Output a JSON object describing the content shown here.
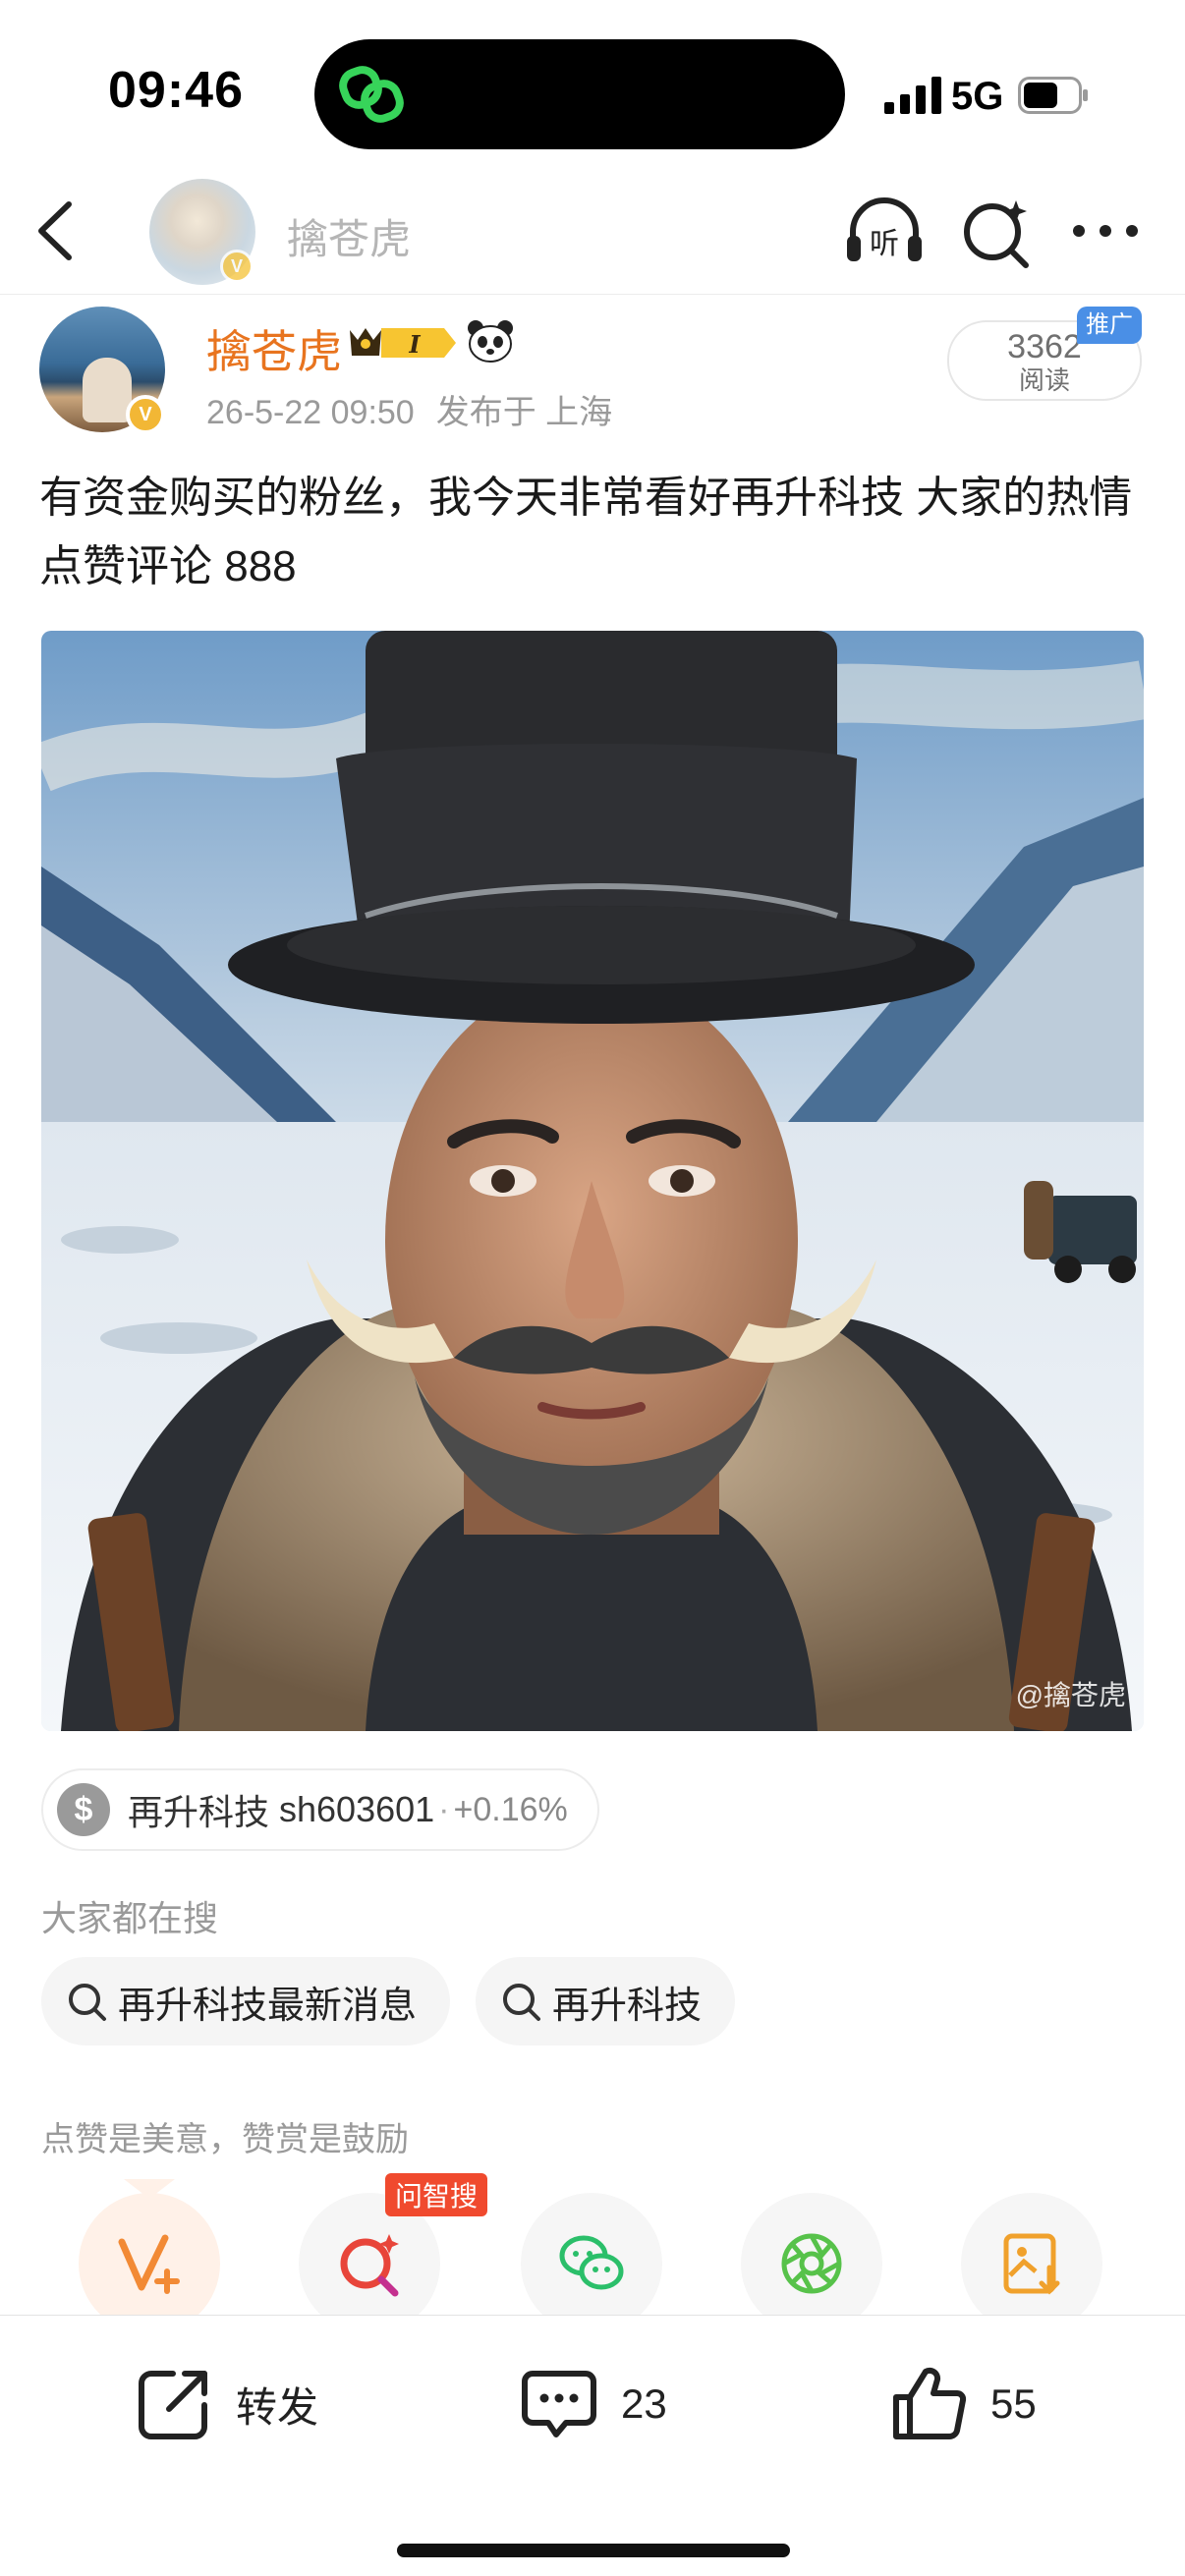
{
  "status_bar": {
    "time": "09:46",
    "network": "5G"
  },
  "nav": {
    "title": "擒苍虎",
    "icons": [
      "back-icon",
      "listen-icon",
      "ai-search-icon",
      "more-icon"
    ]
  },
  "author": {
    "name": "擒苍虎",
    "verified_badge": "V",
    "level_badge": "I",
    "timestamp": "26-5-22 09:50",
    "location": "发布于 上海",
    "reads": "3362",
    "reads_label": "阅读",
    "promo_tag": "推广"
  },
  "post": {
    "text": "有资金购买的粉丝，我今天非常看好再升科技 大家的热情点赞评论 888",
    "image_watermark": "@擒苍虎"
  },
  "stock": {
    "icon": "$",
    "name": "再升科技",
    "code": "sh603601",
    "separator": "·",
    "change": "+0.16%"
  },
  "searching": {
    "heading": "大家都在搜",
    "items": [
      "再升科技最新消息",
      "再升科技"
    ]
  },
  "reward_text": "点赞是美意，赞赏是鼓励",
  "share": {
    "ask_tag": "问智搜",
    "colors": {
      "reward": "#f28a35",
      "ask": "#e8453a",
      "wechat": "#2bbf6a",
      "moments": "#57c24a",
      "save": "#f0a12c"
    }
  },
  "actions": {
    "repost_label": "转发",
    "comment_count": "23",
    "like_count": "55"
  },
  "colors": {
    "author_name": "#e8741f",
    "promo": "#4a8fe6",
    "ask_tag": "#f04a2e"
  }
}
